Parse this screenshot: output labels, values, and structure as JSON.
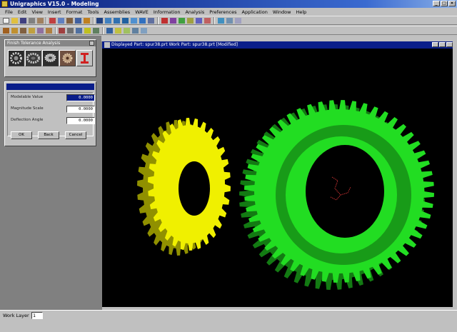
{
  "app": {
    "title": "Unigraphics V15.0 - Modeling"
  },
  "menu": [
    "File",
    "Edit",
    "View",
    "Insert",
    "Format",
    "Tools",
    "Assemblies",
    "WAVE",
    "Information",
    "Analysis",
    "Preferences",
    "Application",
    "Window",
    "Help"
  ],
  "palette": {
    "title": "Finish Tolerance Analysis",
    "icons": [
      "spur-gear-icon",
      "helical-gear-icon",
      "bevel-gear-icon",
      "gear-settings-icon",
      "ibeam-icon"
    ]
  },
  "dialog": {
    "rows": [
      {
        "label": "Modelable Value",
        "value": "0.0000"
      },
      {
        "label": "Magnitude Scale",
        "value": "0.0000"
      },
      {
        "label": "Deflection Angle",
        "value": "0.0000"
      }
    ],
    "buttons": {
      "ok": "OK",
      "back": "Back",
      "cancel": "Cancel"
    }
  },
  "graphics_window": {
    "title": "Displayed Part: spur38.prt   Work Part: spur38.prt [Modified]"
  },
  "viewport": {
    "background": "#000000",
    "small_gear_color": "#f0f000",
    "large_gear_color": "#22dd22",
    "small_gear_teeth": 30,
    "large_gear_teeth": 52
  },
  "status": {
    "label": "Work Layer",
    "value": "1"
  }
}
